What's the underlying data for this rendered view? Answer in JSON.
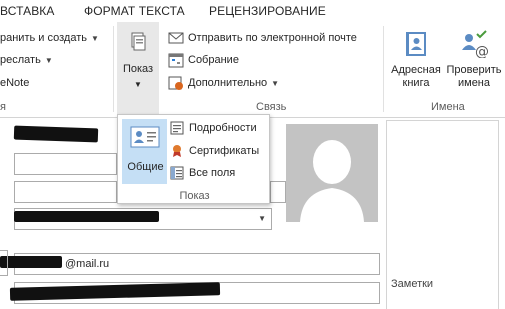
{
  "tabs": [
    "ВСТАВКА",
    "ФОРМАТ ТЕКСТА",
    "РЕЦЕНЗИРОВАНИЕ"
  ],
  "ribbon": {
    "left_items": [
      "ранить и создать",
      "реслать",
      "eNote"
    ],
    "left_group_label": "я",
    "show_button_label": "Показ",
    "communicate_items": [
      "Отправить по электронной почте",
      "Собрание",
      "Дополнительно"
    ],
    "communicate_group_label": "Связь",
    "address_book_label": "Адресная книга",
    "check_names_label": "Проверить имена",
    "names_group_label": "Имена"
  },
  "popup": {
    "general_label": "Общие",
    "items": [
      "Подробности",
      "Сертификаты",
      "Все поля"
    ],
    "group_label": "Показ"
  },
  "form": {
    "email_value": "@mail.ru",
    "notes_label": "Заметки"
  },
  "colors": {
    "popup_selected": "#c5dff5",
    "photo_bg": "#c3c3c3",
    "show_button_bg": "#e8e8e8"
  }
}
